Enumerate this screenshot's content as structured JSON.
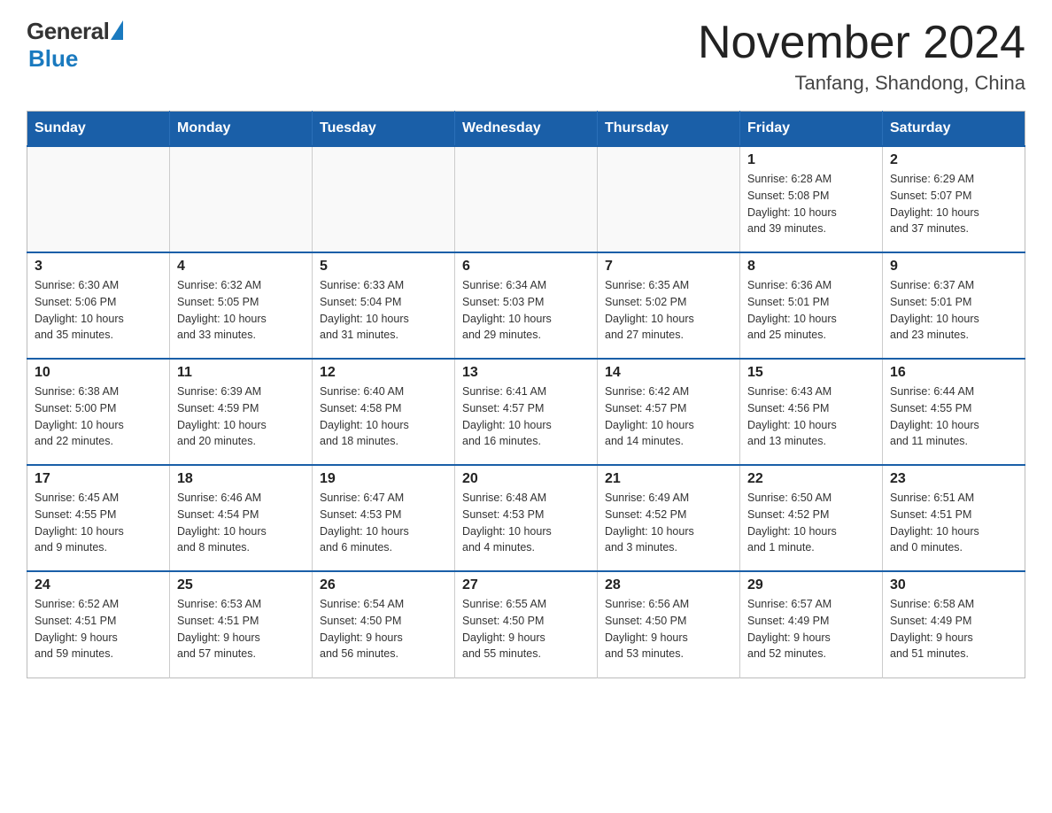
{
  "logo": {
    "general": "General",
    "blue": "Blue"
  },
  "header": {
    "title": "November 2024",
    "subtitle": "Tanfang, Shandong, China"
  },
  "days_of_week": [
    "Sunday",
    "Monday",
    "Tuesday",
    "Wednesday",
    "Thursday",
    "Friday",
    "Saturday"
  ],
  "weeks": [
    [
      {
        "day": "",
        "info": ""
      },
      {
        "day": "",
        "info": ""
      },
      {
        "day": "",
        "info": ""
      },
      {
        "day": "",
        "info": ""
      },
      {
        "day": "",
        "info": ""
      },
      {
        "day": "1",
        "info": "Sunrise: 6:28 AM\nSunset: 5:08 PM\nDaylight: 10 hours\nand 39 minutes."
      },
      {
        "day": "2",
        "info": "Sunrise: 6:29 AM\nSunset: 5:07 PM\nDaylight: 10 hours\nand 37 minutes."
      }
    ],
    [
      {
        "day": "3",
        "info": "Sunrise: 6:30 AM\nSunset: 5:06 PM\nDaylight: 10 hours\nand 35 minutes."
      },
      {
        "day": "4",
        "info": "Sunrise: 6:32 AM\nSunset: 5:05 PM\nDaylight: 10 hours\nand 33 minutes."
      },
      {
        "day": "5",
        "info": "Sunrise: 6:33 AM\nSunset: 5:04 PM\nDaylight: 10 hours\nand 31 minutes."
      },
      {
        "day": "6",
        "info": "Sunrise: 6:34 AM\nSunset: 5:03 PM\nDaylight: 10 hours\nand 29 minutes."
      },
      {
        "day": "7",
        "info": "Sunrise: 6:35 AM\nSunset: 5:02 PM\nDaylight: 10 hours\nand 27 minutes."
      },
      {
        "day": "8",
        "info": "Sunrise: 6:36 AM\nSunset: 5:01 PM\nDaylight: 10 hours\nand 25 minutes."
      },
      {
        "day": "9",
        "info": "Sunrise: 6:37 AM\nSunset: 5:01 PM\nDaylight: 10 hours\nand 23 minutes."
      }
    ],
    [
      {
        "day": "10",
        "info": "Sunrise: 6:38 AM\nSunset: 5:00 PM\nDaylight: 10 hours\nand 22 minutes."
      },
      {
        "day": "11",
        "info": "Sunrise: 6:39 AM\nSunset: 4:59 PM\nDaylight: 10 hours\nand 20 minutes."
      },
      {
        "day": "12",
        "info": "Sunrise: 6:40 AM\nSunset: 4:58 PM\nDaylight: 10 hours\nand 18 minutes."
      },
      {
        "day": "13",
        "info": "Sunrise: 6:41 AM\nSunset: 4:57 PM\nDaylight: 10 hours\nand 16 minutes."
      },
      {
        "day": "14",
        "info": "Sunrise: 6:42 AM\nSunset: 4:57 PM\nDaylight: 10 hours\nand 14 minutes."
      },
      {
        "day": "15",
        "info": "Sunrise: 6:43 AM\nSunset: 4:56 PM\nDaylight: 10 hours\nand 13 minutes."
      },
      {
        "day": "16",
        "info": "Sunrise: 6:44 AM\nSunset: 4:55 PM\nDaylight: 10 hours\nand 11 minutes."
      }
    ],
    [
      {
        "day": "17",
        "info": "Sunrise: 6:45 AM\nSunset: 4:55 PM\nDaylight: 10 hours\nand 9 minutes."
      },
      {
        "day": "18",
        "info": "Sunrise: 6:46 AM\nSunset: 4:54 PM\nDaylight: 10 hours\nand 8 minutes."
      },
      {
        "day": "19",
        "info": "Sunrise: 6:47 AM\nSunset: 4:53 PM\nDaylight: 10 hours\nand 6 minutes."
      },
      {
        "day": "20",
        "info": "Sunrise: 6:48 AM\nSunset: 4:53 PM\nDaylight: 10 hours\nand 4 minutes."
      },
      {
        "day": "21",
        "info": "Sunrise: 6:49 AM\nSunset: 4:52 PM\nDaylight: 10 hours\nand 3 minutes."
      },
      {
        "day": "22",
        "info": "Sunrise: 6:50 AM\nSunset: 4:52 PM\nDaylight: 10 hours\nand 1 minute."
      },
      {
        "day": "23",
        "info": "Sunrise: 6:51 AM\nSunset: 4:51 PM\nDaylight: 10 hours\nand 0 minutes."
      }
    ],
    [
      {
        "day": "24",
        "info": "Sunrise: 6:52 AM\nSunset: 4:51 PM\nDaylight: 9 hours\nand 59 minutes."
      },
      {
        "day": "25",
        "info": "Sunrise: 6:53 AM\nSunset: 4:51 PM\nDaylight: 9 hours\nand 57 minutes."
      },
      {
        "day": "26",
        "info": "Sunrise: 6:54 AM\nSunset: 4:50 PM\nDaylight: 9 hours\nand 56 minutes."
      },
      {
        "day": "27",
        "info": "Sunrise: 6:55 AM\nSunset: 4:50 PM\nDaylight: 9 hours\nand 55 minutes."
      },
      {
        "day": "28",
        "info": "Sunrise: 6:56 AM\nSunset: 4:50 PM\nDaylight: 9 hours\nand 53 minutes."
      },
      {
        "day": "29",
        "info": "Sunrise: 6:57 AM\nSunset: 4:49 PM\nDaylight: 9 hours\nand 52 minutes."
      },
      {
        "day": "30",
        "info": "Sunrise: 6:58 AM\nSunset: 4:49 PM\nDaylight: 9 hours\nand 51 minutes."
      }
    ]
  ]
}
